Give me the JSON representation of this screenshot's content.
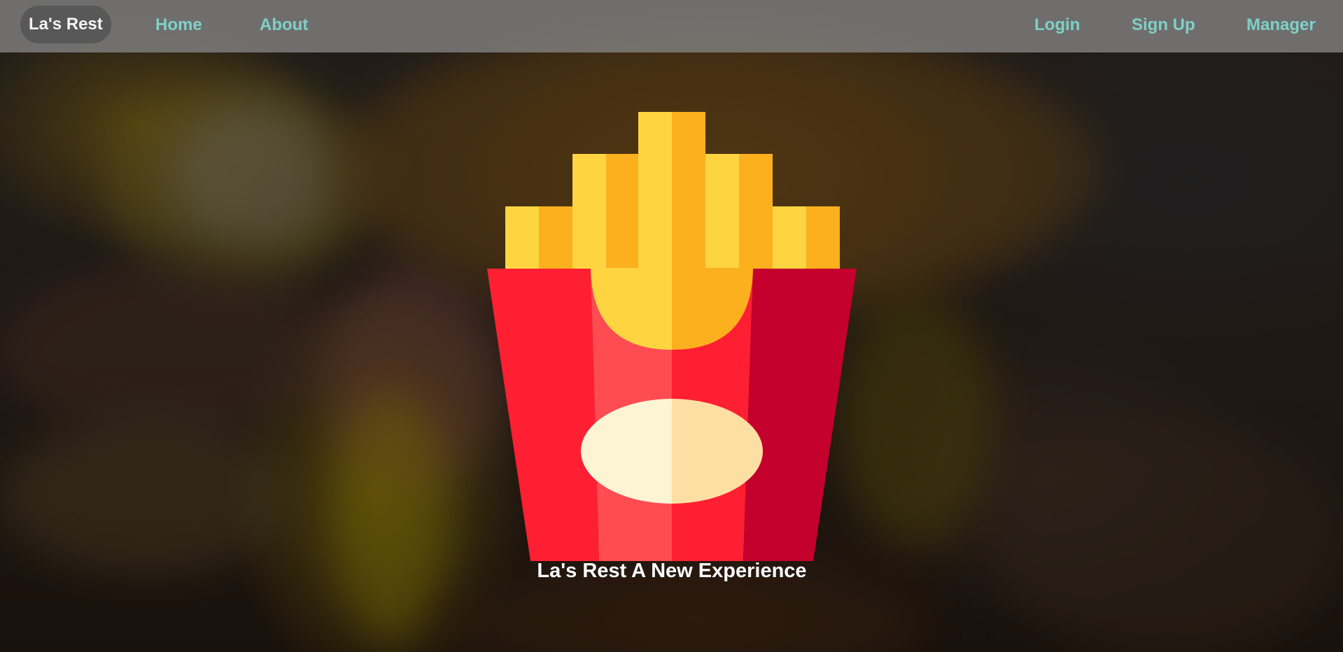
{
  "nav": {
    "brand": "La's Rest",
    "links": {
      "home": "Home",
      "about": "About",
      "login": "Login",
      "signup": "Sign Up",
      "manager": "Manager"
    }
  },
  "hero": {
    "logo_icon": "french-fries-icon",
    "tagline": "La's Rest A New Experience"
  },
  "colors": {
    "nav_link": "#7fd0c8",
    "navbar_bg": "#808080",
    "fries_yellow": "#fed541",
    "fries_orange": "#fdb01e",
    "box_red": "#ff1f33",
    "box_light_red": "#ff4b52",
    "box_dark_red": "#c4002d",
    "label_cream": "#fdf4d4",
    "label_tan": "#fedfa3"
  }
}
